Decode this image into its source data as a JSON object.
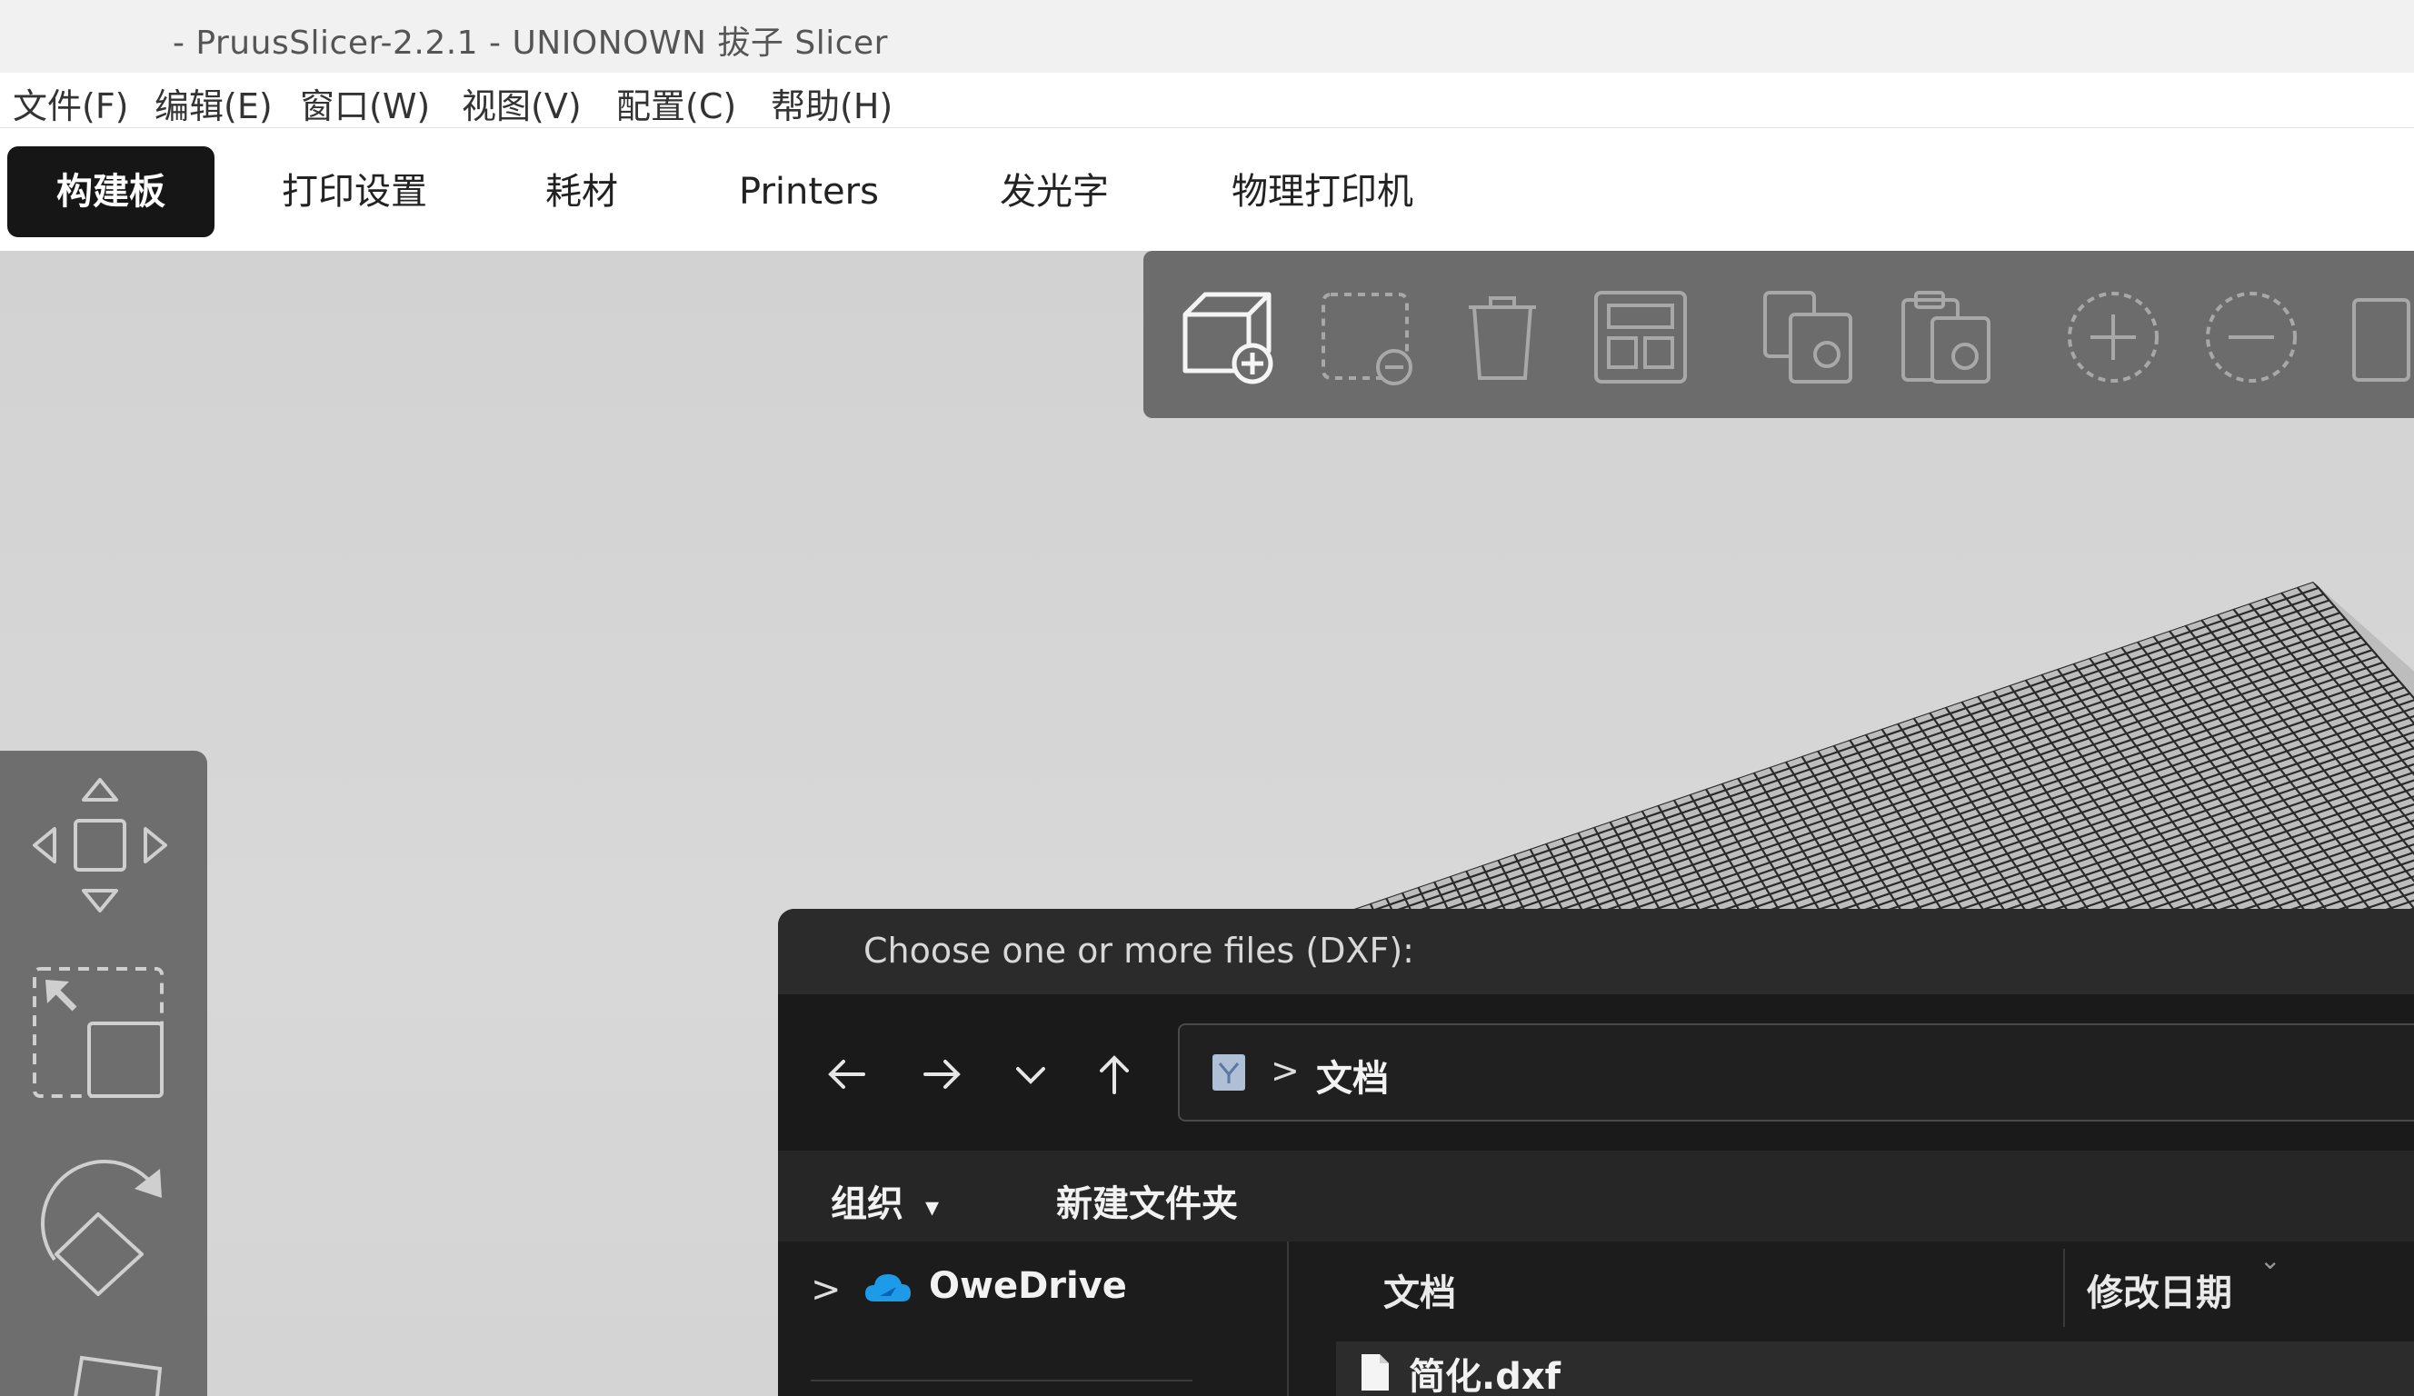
{
  "window": {
    "title": "- PruusSlicer-2.2.1 - UNIONOWN 拔子 Slicer"
  },
  "menu": {
    "items": [
      "文件(F)",
      "编辑(E)",
      "窗口(W)",
      "视图(V)",
      "配置(C)",
      "帮助(H)"
    ]
  },
  "tabs": {
    "items": [
      "构建板",
      "打印设置",
      "耗材",
      "Printers",
      "发光字",
      "物理打印机"
    ],
    "active_index": 0
  },
  "toolbar": {
    "icons": [
      "add-object-icon",
      "delete-selection-icon",
      "delete-all-icon",
      "arrange-icon",
      "copy-icon",
      "paste-icon",
      "add-instance-icon",
      "remove-instance-icon",
      "split-icon"
    ]
  },
  "gizmos": {
    "icons": [
      "move-icon",
      "scale-icon",
      "rotate-icon",
      "place-on-face-icon"
    ]
  },
  "dialog": {
    "title": "Choose one or more files (DXF):",
    "address": {
      "separator": ">",
      "crumb": "文档"
    },
    "commands": {
      "organize": "组织",
      "organize_caret": "▾",
      "new_folder": "新建文件夹"
    },
    "nav_pane": {
      "expand": ">",
      "onedrive": "OweDrive"
    },
    "columns": {
      "name": "文档",
      "modified": "修改日期"
    },
    "files": [
      {
        "name": "简化.dxf"
      }
    ]
  },
  "colors": {
    "active_tab_bg": "#161616",
    "toolbar_bg": "#6c6c6c",
    "dialog_bg": "#1f1f1f",
    "onedrive_blue": "#1e9be8"
  }
}
